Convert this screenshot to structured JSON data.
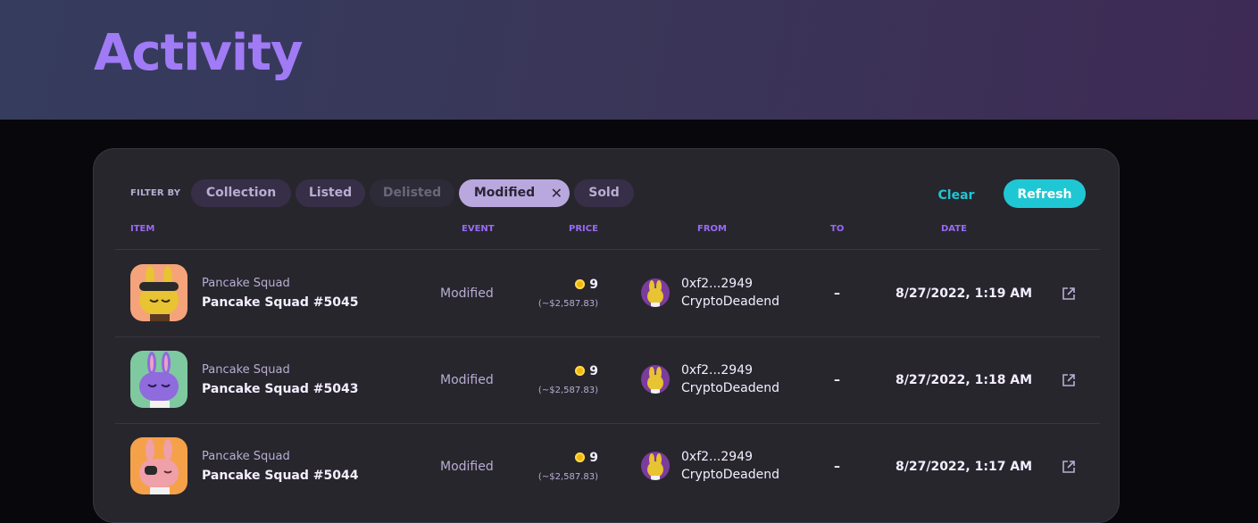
{
  "page": {
    "title": "Activity"
  },
  "filters": {
    "label": "FILTER BY",
    "chips": [
      {
        "label": "Collection",
        "state": "default"
      },
      {
        "label": "Listed",
        "state": "default"
      },
      {
        "label": "Delisted",
        "state": "disabled"
      },
      {
        "label": "Modified",
        "state": "active"
      },
      {
        "label": "Sold",
        "state": "default"
      }
    ],
    "clear_label": "Clear",
    "refresh_label": "Refresh"
  },
  "table": {
    "headers": {
      "item": "ITEM",
      "event": "EVENT",
      "price": "PRICE",
      "from": "FROM",
      "to": "TO",
      "date": "DATE"
    },
    "rows": [
      {
        "collection": "Pancake Squad",
        "name": "Pancake Squad #5045",
        "event": "Modified",
        "price": "9",
        "usd": "(~$2,587.83)",
        "from_address": "0xf2...2949",
        "from_name": "CryptoDeadend",
        "to": "–",
        "date": "8/27/2022, 1:19 AM",
        "thumb_bg": "#f5a37a",
        "bunny_color": "#e8c332"
      },
      {
        "collection": "Pancake Squad",
        "name": "Pancake Squad #5043",
        "event": "Modified",
        "price": "9",
        "usd": "(~$2,587.83)",
        "from_address": "0xf2...2949",
        "from_name": "CryptoDeadend",
        "to": "–",
        "date": "8/27/2022, 1:18 AM",
        "thumb_bg": "#7fc9a0",
        "bunny_color": "#8f6bde"
      },
      {
        "collection": "Pancake Squad",
        "name": "Pancake Squad #5044",
        "event": "Modified",
        "price": "9",
        "usd": "(~$2,587.83)",
        "from_address": "0xf2...2949",
        "from_name": "CryptoDeadend",
        "to": "–",
        "date": "8/27/2022, 1:17 AM",
        "thumb_bg": "#f5a14a",
        "bunny_color": "#f0a0a8"
      }
    ]
  },
  "icons": {
    "bnb_coin": "bnb-coin-icon",
    "external_link": "external-link-icon",
    "close": "close-icon"
  },
  "colors": {
    "accent_purple": "#a07bf5",
    "accent_teal": "#1fc7d4",
    "card_bg": "#27262d"
  }
}
